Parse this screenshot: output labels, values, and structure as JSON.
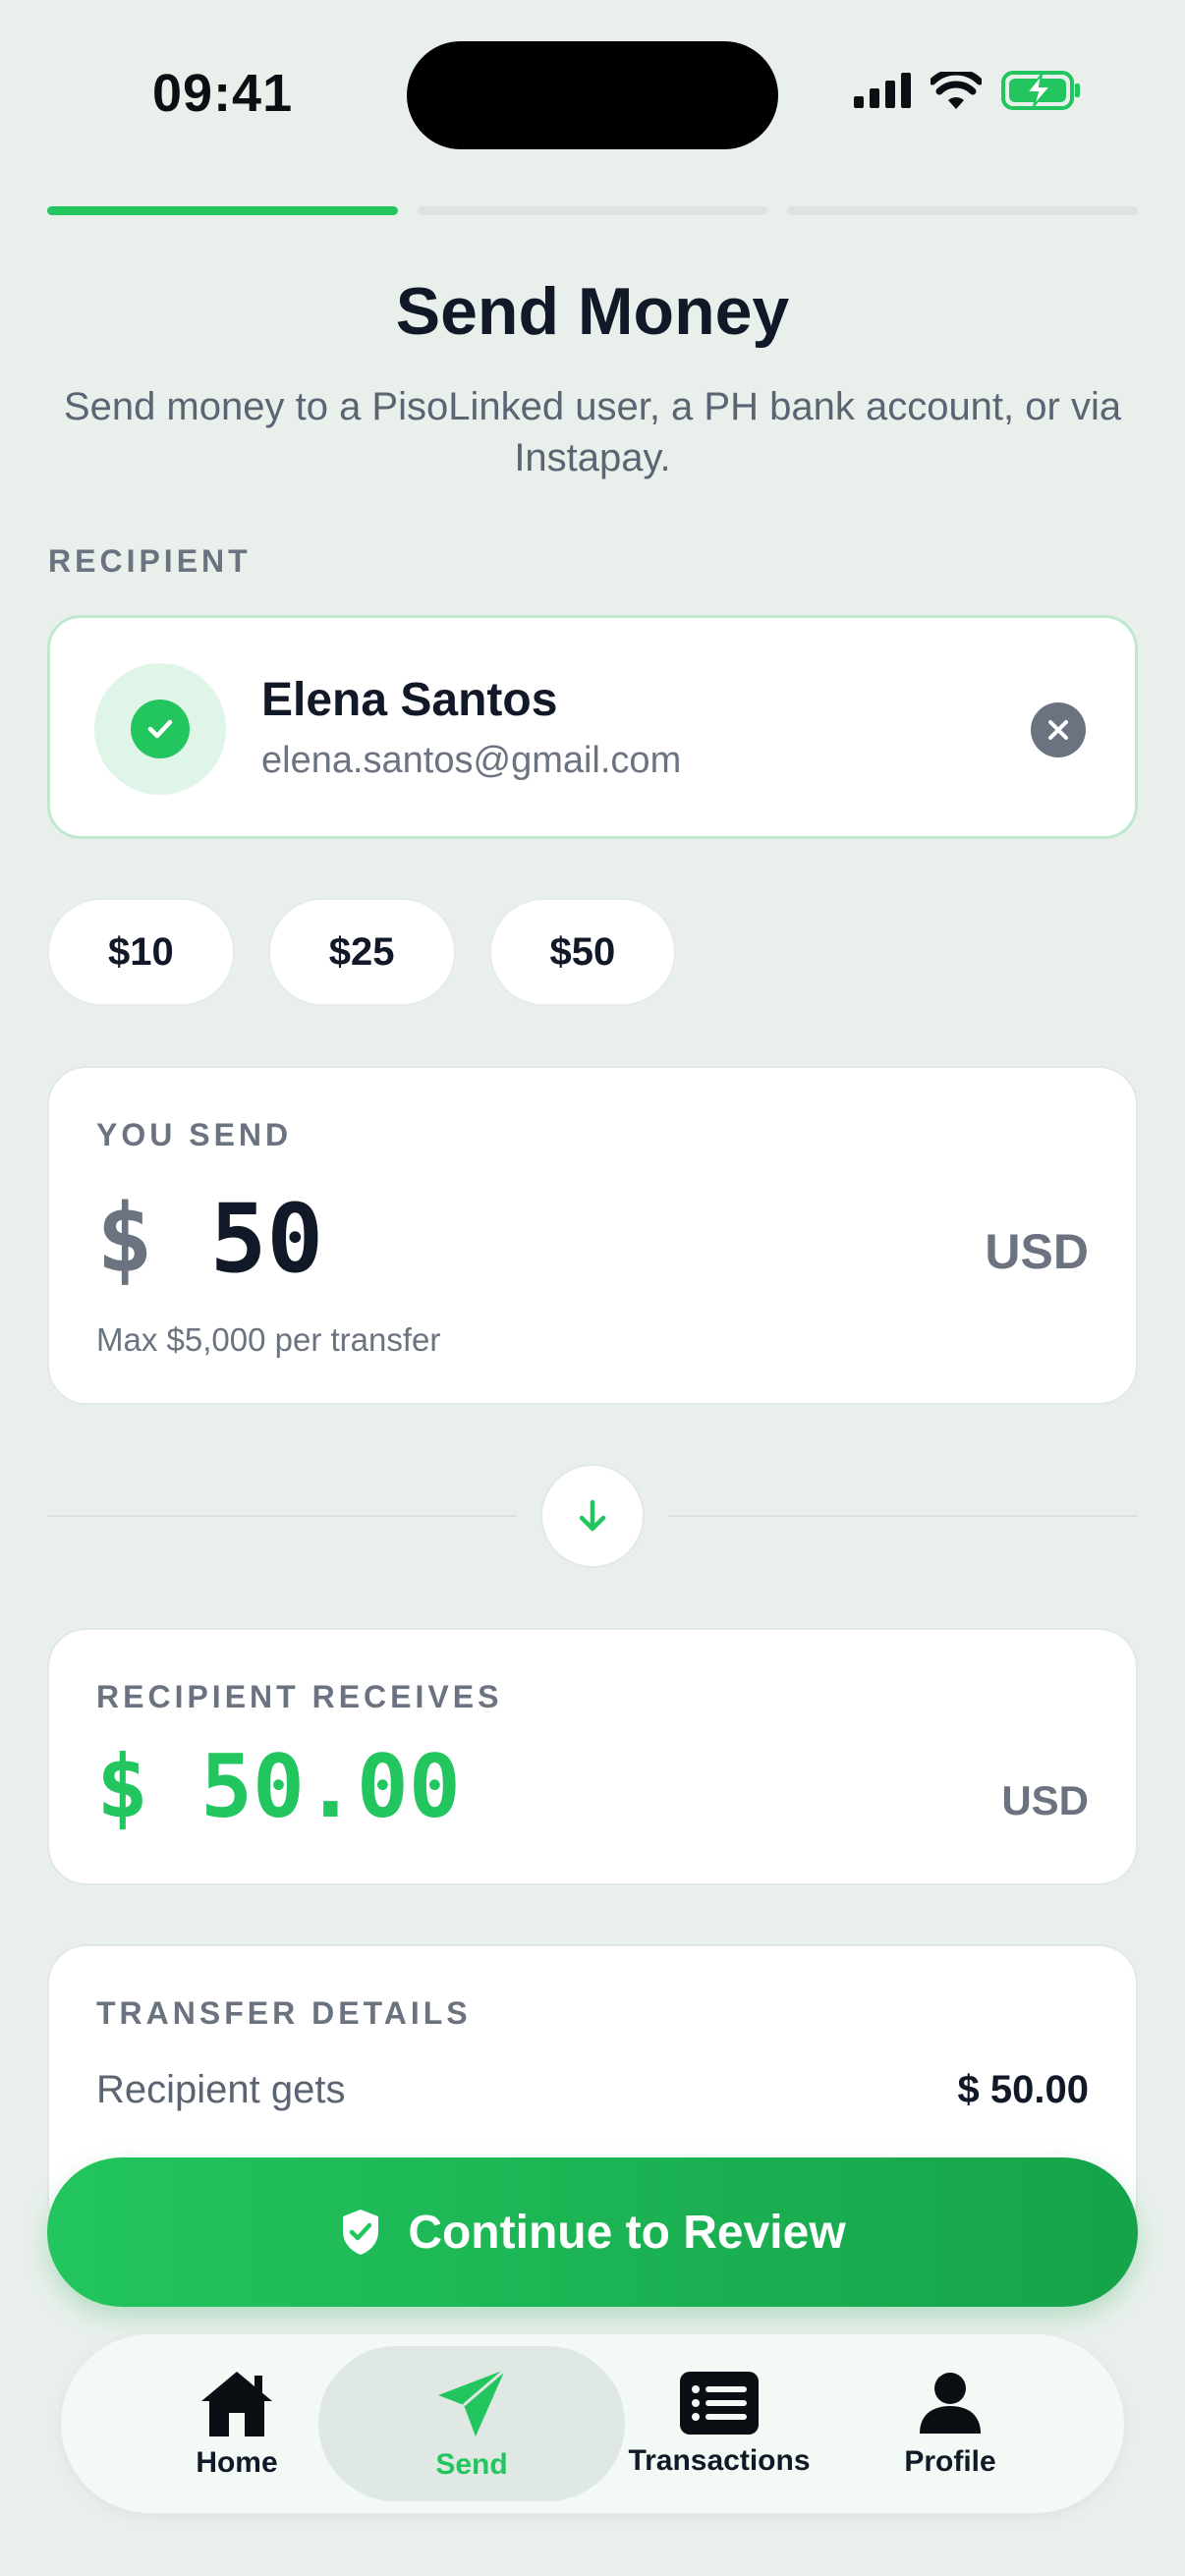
{
  "status_bar": {
    "time": "09:41"
  },
  "progress": {
    "steps": 3,
    "current": 1
  },
  "header": {
    "title": "Send Money",
    "subtitle": "Send money to a PisoLinked user, a PH bank account, or via Instapay."
  },
  "recipient": {
    "section_label": "RECIPIENT",
    "name": "Elena Santos",
    "email": "elena.santos@gmail.com"
  },
  "quick_amounts": [
    "$10",
    "$25",
    "$50"
  ],
  "you_send": {
    "label": "YOU SEND",
    "currency_symbol": "$",
    "amount": "50",
    "currency": "USD",
    "hint": "Max $5,000 per transfer"
  },
  "recipient_receives": {
    "label": "RECIPIENT RECEIVES",
    "amount": "$ 50.00",
    "currency": "USD"
  },
  "transfer_details": {
    "label": "TRANSFER DETAILS",
    "rows": [
      {
        "label": "Recipient gets",
        "value": "$ 50.00"
      }
    ]
  },
  "cta": {
    "label": "Continue to Review"
  },
  "tabs": [
    {
      "label": "Home",
      "icon": "home-icon"
    },
    {
      "label": "Send",
      "icon": "send-icon",
      "active": true
    },
    {
      "label": "Transactions",
      "icon": "transactions-icon"
    },
    {
      "label": "Profile",
      "icon": "profile-icon"
    }
  ],
  "colors": {
    "accent": "#22c55e",
    "accent_dark": "#16a34a",
    "background": "#e9f0ec"
  }
}
